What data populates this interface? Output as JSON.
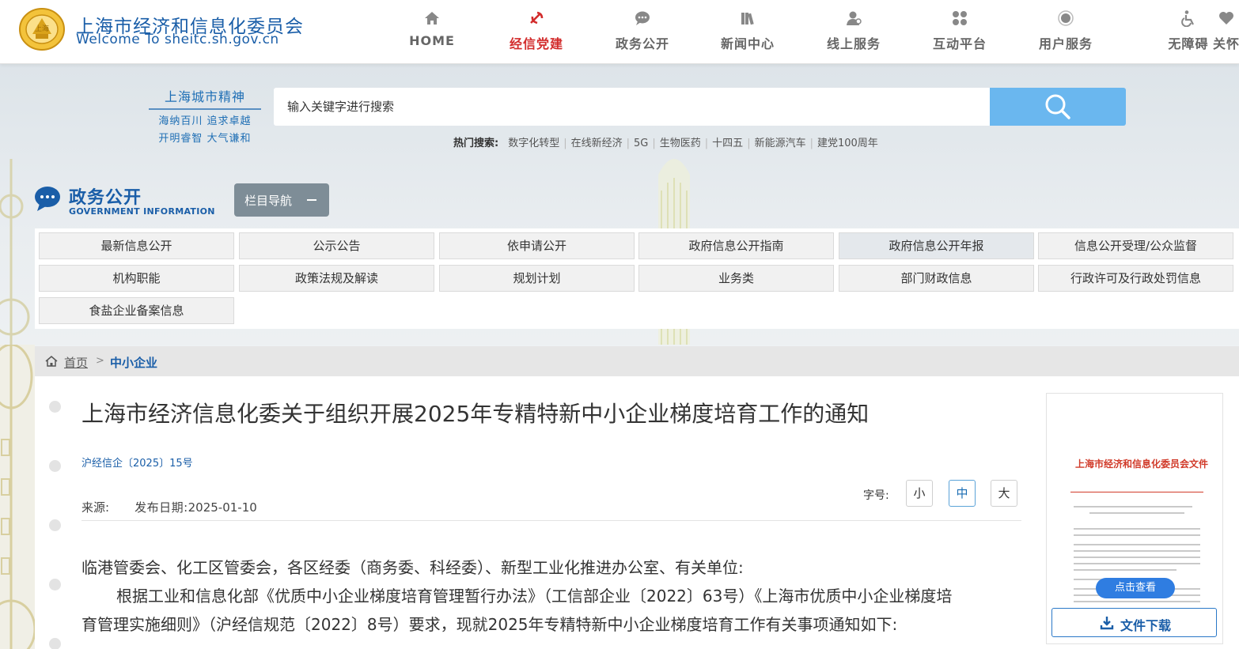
{
  "header": {
    "logo_cn": "上海市经济和信息化委员会",
    "logo_en": "Welcome To sheitc.sh.gov.cn",
    "nav": [
      {
        "label": "HOME",
        "icon": "home-icon"
      },
      {
        "label": "经信党建",
        "icon": "party-emblem-icon"
      },
      {
        "label": "政务公开",
        "icon": "chat-bubble-icon"
      },
      {
        "label": "新闻中心",
        "icon": "books-icon"
      },
      {
        "label": "线上服务",
        "icon": "user-service-icon"
      },
      {
        "label": "互动平台",
        "icon": "interaction-icon"
      },
      {
        "label": "用户服务",
        "icon": "user-icon"
      },
      {
        "label": "无障碍",
        "icon": "wheelchair-icon"
      },
      {
        "label": "关怀",
        "icon": "heart-icon"
      }
    ],
    "active_nav": "经信党建",
    "active_color": "#d22b2b"
  },
  "banner": {
    "spirit_title": "上海城市精神",
    "spirit_line1": "海纳百川 追求卓越",
    "spirit_line2": "开明睿智 大气谦和",
    "search_placeholder": "输入关键字进行搜索",
    "hot_label": "热门搜索:",
    "hot_items": [
      "数字化转型",
      "在线新经济",
      "5G",
      "生物医药",
      "十四五",
      "新能源汽车",
      "建党100周年"
    ],
    "search_button_color": "#6ab7ef"
  },
  "gov": {
    "title": "政务公开",
    "subtitle": "GOVERNMENT INFORMATION",
    "column_nav": "栏目导航",
    "items": [
      "最新信息公开",
      "公示公告",
      "依申请公开",
      "政府信息公开指南",
      "政府信息公开年报",
      "信息公开受理/公众监督",
      "机构职能",
      "政策法规及解读",
      "规划计划",
      "业务类",
      "部门财政信息",
      "行政许可及行政处罚信息",
      "食盐企业备案信息"
    ]
  },
  "breadcrumb": {
    "home": "首页",
    "separator": ">",
    "current": "中小企业"
  },
  "article": {
    "title": "上海市经济信息化委关于组织开展2025年专精特新中小企业梯度培育工作的通知",
    "doc_no": "沪经信企〔2025〕15号",
    "font_label": "字号:",
    "font_sizes": [
      "小",
      "中",
      "大"
    ],
    "active_font": "中",
    "source_label": "来源:",
    "publish_label": "发布日期:",
    "publish_date": "2025-01-10",
    "para1": "临港管委会、化工区管委会，各区经委（商务委、科经委）、新型工业化推进办公室、有关单位:",
    "para2a": "根据工业和信息化部《优质中小企业梯度培育管理暂行办法》（工信部企业〔2022〕63号）《上海市优质中小企业梯度培",
    "para2b": "育管理实施细则》（沪经信规范〔2022〕8号）要求，现就2025年专精特新中小企业梯度培育工作有关事项通知如下:"
  },
  "attachment": {
    "doc_header": "上海市经济和信息化委员会文件",
    "view_button": "点击查看",
    "download_button": "文件下载"
  }
}
